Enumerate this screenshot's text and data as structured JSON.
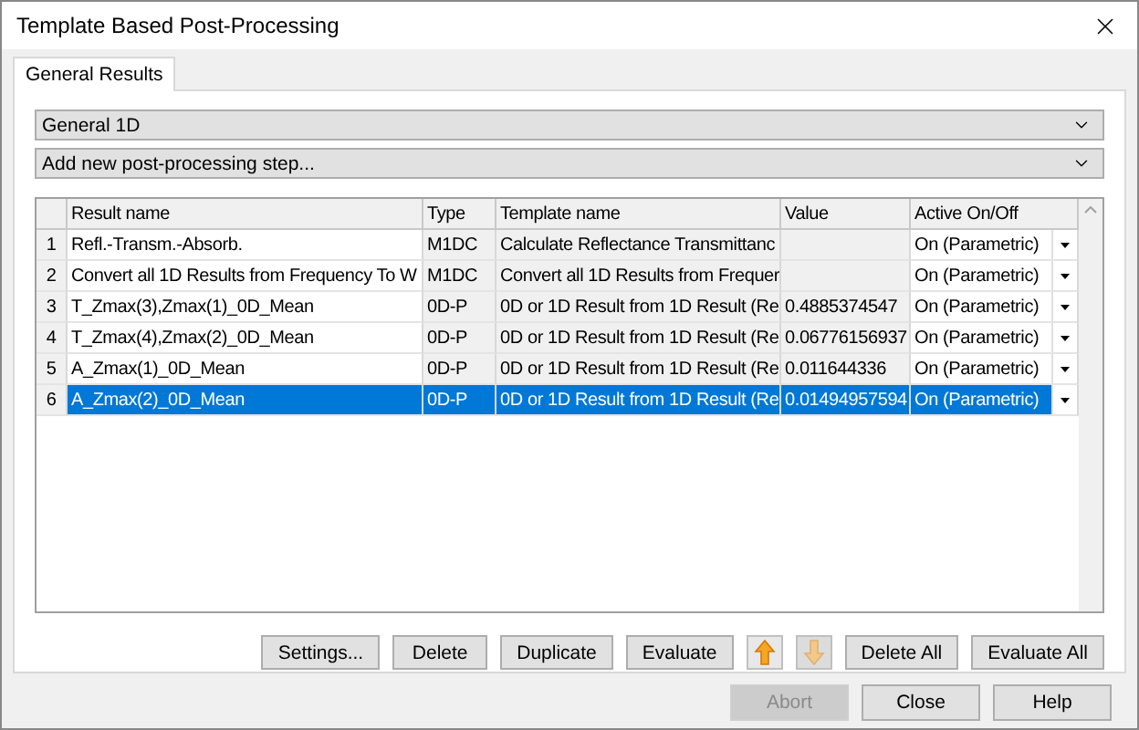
{
  "window": {
    "title": "Template Based Post-Processing"
  },
  "tabs": [
    {
      "label": "General Results",
      "selected": true
    }
  ],
  "dropdowns": [
    {
      "value": "General 1D"
    },
    {
      "value": "Add new post-processing step..."
    }
  ],
  "table": {
    "columns": [
      "Result name",
      "Type",
      "Template name",
      "Value",
      "Active On/Off"
    ],
    "rows": [
      {
        "number": "1",
        "result_name": "Refl.-Transm.-Absorb.",
        "type": "M1DC",
        "template_name": "Calculate Reflectance Transmittanc",
        "active": "On (Parametric)",
        "selected": false
      },
      {
        "number": "2",
        "result_name": "Convert all 1D Results from Frequency To W",
        "type": "M1DC",
        "template_name": "Convert all 1D Results from Frequer",
        "active": "On (Parametric)",
        "selected": false
      },
      {
        "number": "3",
        "result_name": "T_Zmax(3),Zmax(1)_0D_Mean",
        "type": "0D-P",
        "template_name": "0D or 1D Result from 1D Result (Re",
        "value": "0.4885374547",
        "active": "On (Parametric)",
        "selected": false
      },
      {
        "number": "4",
        "result_name": "T_Zmax(4),Zmax(2)_0D_Mean",
        "type": "0D-P",
        "template_name": "0D or 1D Result from 1D Result (Re",
        "value": "0.06776156937",
        "active": "On (Parametric)",
        "selected": false
      },
      {
        "number": "5",
        "result_name": "A_Zmax(1)_0D_Mean",
        "type": "0D-P",
        "template_name": "0D or 1D Result from 1D Result (Re",
        "value": "0.011644336",
        "active": "On (Parametric)",
        "selected": false
      },
      {
        "number": "6",
        "result_name": "A_Zmax(2)_0D_Mean",
        "type": "0D-P",
        "template_name": "0D or 1D Result from 1D Result (Re",
        "value": "0.01494957594",
        "active": "On (Parametric)",
        "selected": true
      }
    ]
  },
  "buttons": [
    {
      "kind": "text",
      "label": "Settings...",
      "disabled": false
    },
    {
      "kind": "text",
      "label": "Delete",
      "disabled": false
    },
    {
      "kind": "text",
      "label": "Duplicate",
      "disabled": false
    },
    {
      "kind": "text",
      "label": "Evaluate",
      "disabled": false
    },
    {
      "kind": "up",
      "disabled": false
    },
    {
      "kind": "down",
      "disabled": true
    },
    {
      "kind": "text",
      "label": "Delete All",
      "disabled": false
    },
    {
      "kind": "text",
      "label": "Evaluate All",
      "disabled": false
    }
  ],
  "footer_buttons": [
    {
      "label": "Abort",
      "disabled": true
    },
    {
      "label": "Close",
      "disabled": false
    },
    {
      "label": "Help",
      "disabled": false
    }
  ]
}
